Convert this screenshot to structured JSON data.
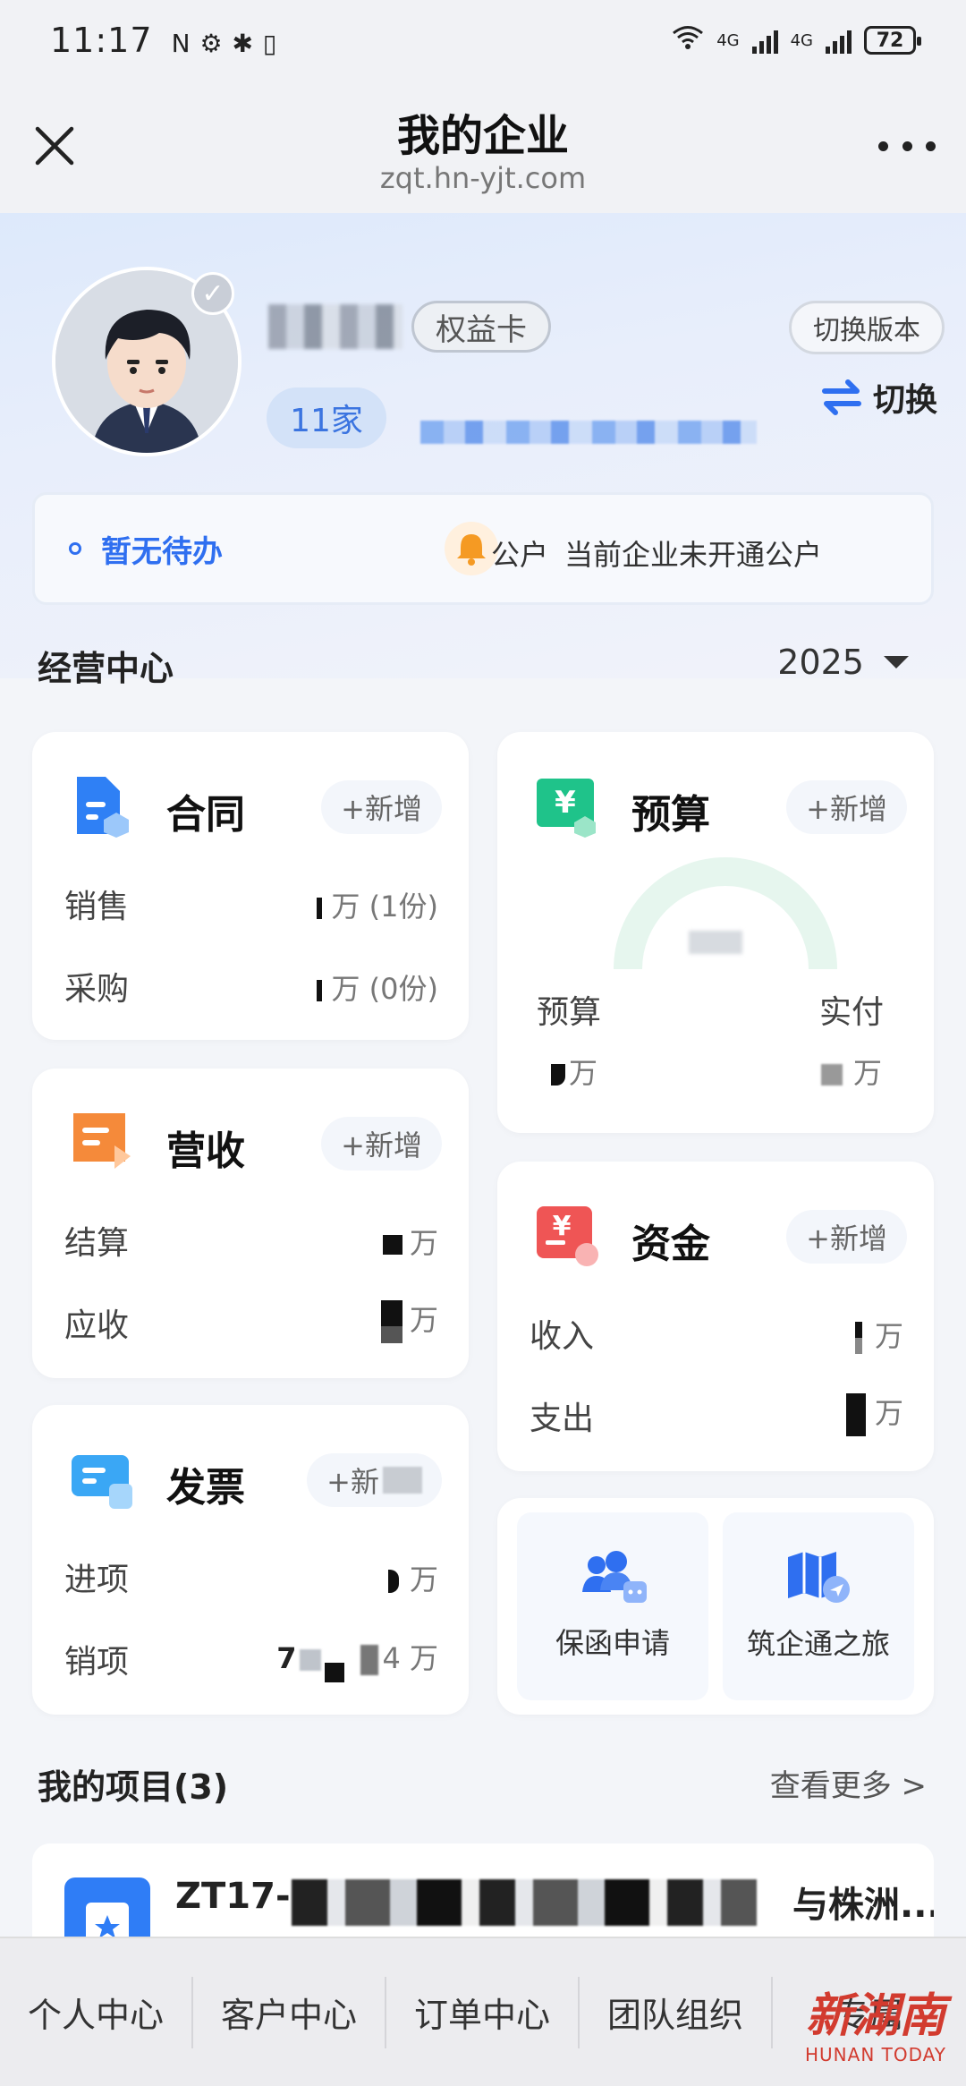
{
  "status_bar": {
    "time": "11:17",
    "network_labels": [
      "4G",
      "4G"
    ],
    "battery": "72"
  },
  "nav": {
    "title": "我的企业",
    "url": "zqt.hn-yjt.com"
  },
  "profile": {
    "name": "",
    "rights_card_label": "权益卡",
    "switch_version_label": "切换版本",
    "company_count": "11家",
    "switch_label": "切换"
  },
  "todo": {
    "text": "暂无待办",
    "notice_prefix": "公户",
    "notice": "当前企业未开通公户"
  },
  "business_center": {
    "title": "经营中心",
    "year": "2025"
  },
  "cards": {
    "contract": {
      "title": "合同",
      "add_label": "+新增",
      "rows": [
        {
          "label": "销售",
          "value": "万 (1份)"
        },
        {
          "label": "采购",
          "value": "万 (0份)"
        }
      ]
    },
    "budget": {
      "title": "预算",
      "add_label": "+新增",
      "left_label": "预算",
      "right_label": "实付",
      "left_unit": "万",
      "right_unit": "万"
    },
    "revenue": {
      "title": "营收",
      "add_label": "+新增",
      "rows": [
        {
          "label": "结算",
          "value": "万"
        },
        {
          "label": "应收",
          "value": "万"
        }
      ]
    },
    "funds": {
      "title": "资金",
      "add_label": "+新增",
      "rows": [
        {
          "label": "收入",
          "value": "万"
        },
        {
          "label": "支出",
          "value": "万"
        }
      ]
    },
    "invoice": {
      "title": "发票",
      "add_label": "+新",
      "rows": [
        {
          "label": "进项",
          "value": "万"
        },
        {
          "label": "销项",
          "value": "4 万"
        }
      ],
      "sale_prefix": "7"
    }
  },
  "entries": [
    {
      "label": "保函申请",
      "icon": "people-icon"
    },
    {
      "label": "筑企通之旅",
      "icon": "map-icon"
    }
  ],
  "projects": {
    "title": "我的项目(3)",
    "see_more": "查看更多 >",
    "first_name_start": "ZT17-",
    "first_name_end": "与株洲..."
  },
  "tabs": [
    "个人中心",
    "客户中心",
    "订单中心",
    "团队组织",
    "专属"
  ],
  "watermark": {
    "cn": "新湖南",
    "en": "HUNAN TODAY"
  },
  "colors": {
    "primary_blue": "#2f6ff0",
    "contract_blue": "#2f80f5",
    "budget_green": "#1fc38a",
    "revenue_orange": "#f58a3a",
    "funds_red": "#ef5555",
    "invoice_cyan": "#3aa7f5",
    "watermark_red": "#d23b2f"
  }
}
